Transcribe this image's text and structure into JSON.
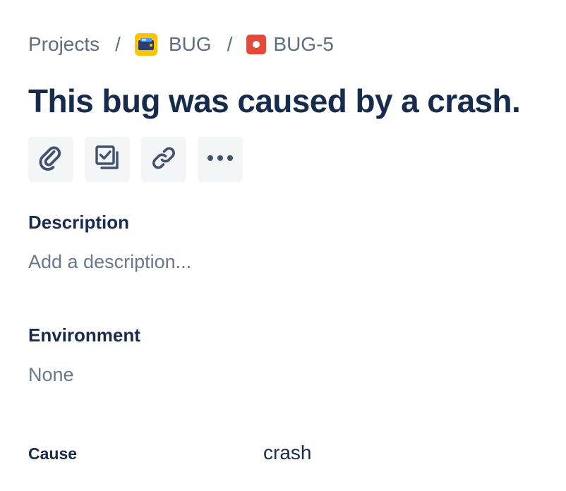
{
  "breadcrumb": {
    "projects_label": "Projects",
    "separator": "/",
    "project_key": "BUG",
    "issue_key": "BUG-5"
  },
  "issue": {
    "title": "This bug was caused by a crash."
  },
  "toolbar": {
    "icons": [
      "paperclip-icon",
      "subtask-icon",
      "link-icon",
      "more-icon"
    ]
  },
  "description": {
    "label": "Description",
    "placeholder": "Add a description..."
  },
  "environment": {
    "label": "Environment",
    "value": "None"
  },
  "fields": {
    "cause_label": "Cause",
    "cause_value": "crash"
  },
  "colors": {
    "project_icon_bg": "#ffc400",
    "bug_icon_bg": "#e5493a",
    "text_primary": "#172b4d",
    "text_subtle": "#6b778c",
    "button_bg": "#f4f5f7"
  }
}
